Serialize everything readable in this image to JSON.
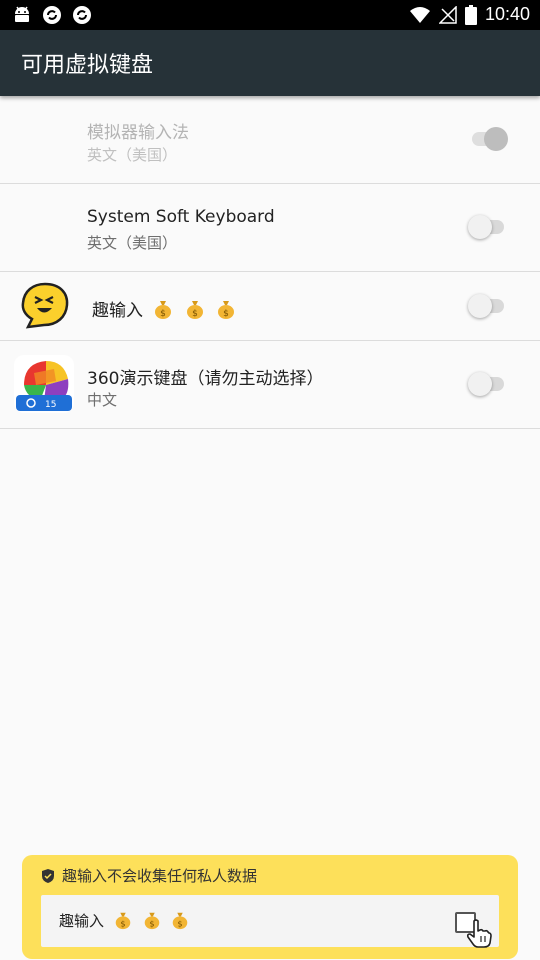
{
  "status_bar": {
    "time": "10:40",
    "left_icons": [
      "android-icon",
      "sync-icon",
      "sync-icon"
    ],
    "right_icons": [
      "wifi-icon",
      "no-signal-icon",
      "battery-icon"
    ]
  },
  "app_bar": {
    "title": "可用虚拟键盘"
  },
  "keyboards": [
    {
      "name": "模拟器输入法",
      "subtitle": "英文（美国）",
      "enabled": true,
      "disabled_control": true
    },
    {
      "name": "System Soft Keyboard",
      "subtitle": "英文（美国）",
      "enabled": false
    },
    {
      "name": "趣输入",
      "subtitle": "",
      "enabled": false,
      "emoji_suffix": [
        "money-bag-icon",
        "money-bag-icon",
        "money-bag-icon"
      ]
    },
    {
      "name": "360演示键盘（请勿主动选择）",
      "subtitle": "中文",
      "enabled": false
    }
  ],
  "privacy_banner": {
    "heading": "趣输入不会收集任何私人数据",
    "item_label": "趣输入",
    "item_checked": false,
    "colors": {
      "background": "#fde05a"
    }
  },
  "colors": {
    "app_bar": "#263238",
    "status_bar": "#000000",
    "background": "#fafafa"
  }
}
